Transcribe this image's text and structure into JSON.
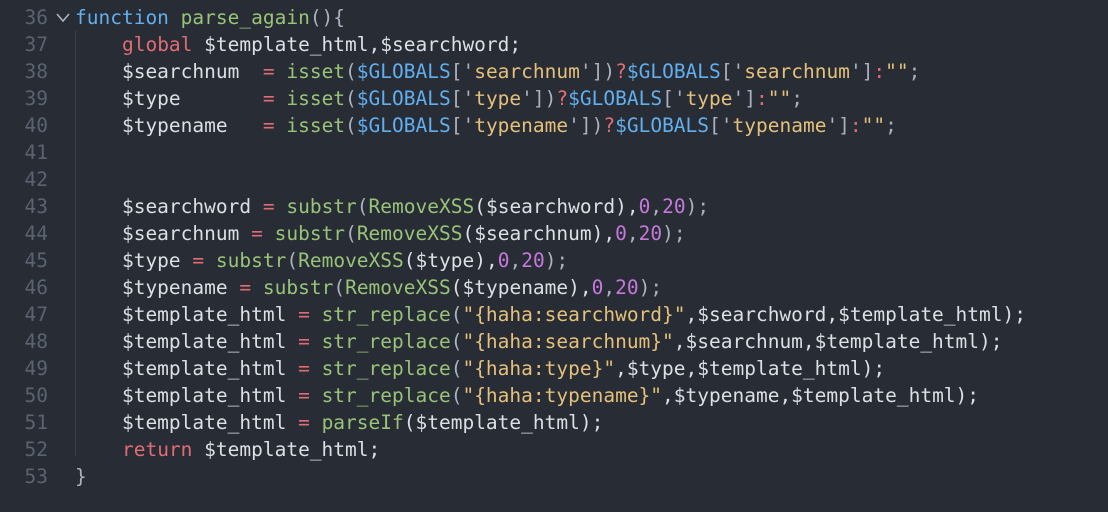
{
  "editor": {
    "lines": [
      {
        "num": "36",
        "tokens": [
          {
            "t": "function",
            "c": "kw-fn"
          },
          {
            "t": " ",
            "c": "var"
          },
          {
            "t": "parse_again",
            "c": "fn"
          },
          {
            "t": "(){",
            "c": "punc"
          }
        ]
      },
      {
        "num": "37",
        "tokens": [
          {
            "t": "    ",
            "c": "var"
          },
          {
            "t": "global",
            "c": "kw"
          },
          {
            "t": " $template_html,$searchword;",
            "c": "var"
          }
        ]
      },
      {
        "num": "38",
        "tokens": [
          {
            "t": "    $searchnum  ",
            "c": "var"
          },
          {
            "t": "=",
            "c": "op"
          },
          {
            "t": " ",
            "c": "var"
          },
          {
            "t": "isset",
            "c": "fn"
          },
          {
            "t": "(",
            "c": "punc"
          },
          {
            "t": "$GLOBALS",
            "c": "glob"
          },
          {
            "t": "['",
            "c": "punc"
          },
          {
            "t": "searchnum",
            "c": "str"
          },
          {
            "t": "'])",
            "c": "punc"
          },
          {
            "t": "?",
            "c": "op"
          },
          {
            "t": "$GLOBALS",
            "c": "glob"
          },
          {
            "t": "['",
            "c": "punc"
          },
          {
            "t": "searchnum",
            "c": "str"
          },
          {
            "t": "']",
            "c": "punc"
          },
          {
            "t": ":",
            "c": "op"
          },
          {
            "t": "\"\"",
            "c": "str"
          },
          {
            "t": ";",
            "c": "punc"
          }
        ]
      },
      {
        "num": "39",
        "tokens": [
          {
            "t": "    $type       ",
            "c": "var"
          },
          {
            "t": "=",
            "c": "op"
          },
          {
            "t": " ",
            "c": "var"
          },
          {
            "t": "isset",
            "c": "fn"
          },
          {
            "t": "(",
            "c": "punc"
          },
          {
            "t": "$GLOBALS",
            "c": "glob"
          },
          {
            "t": "['",
            "c": "punc"
          },
          {
            "t": "type",
            "c": "str"
          },
          {
            "t": "'])",
            "c": "punc"
          },
          {
            "t": "?",
            "c": "op"
          },
          {
            "t": "$GLOBALS",
            "c": "glob"
          },
          {
            "t": "['",
            "c": "punc"
          },
          {
            "t": "type",
            "c": "str"
          },
          {
            "t": "']",
            "c": "punc"
          },
          {
            "t": ":",
            "c": "op"
          },
          {
            "t": "\"\"",
            "c": "str"
          },
          {
            "t": ";",
            "c": "punc"
          }
        ]
      },
      {
        "num": "40",
        "tokens": [
          {
            "t": "    $typename   ",
            "c": "var"
          },
          {
            "t": "=",
            "c": "op"
          },
          {
            "t": " ",
            "c": "var"
          },
          {
            "t": "isset",
            "c": "fn"
          },
          {
            "t": "(",
            "c": "punc"
          },
          {
            "t": "$GLOBALS",
            "c": "glob"
          },
          {
            "t": "['",
            "c": "punc"
          },
          {
            "t": "typename",
            "c": "str"
          },
          {
            "t": "'])",
            "c": "punc"
          },
          {
            "t": "?",
            "c": "op"
          },
          {
            "t": "$GLOBALS",
            "c": "glob"
          },
          {
            "t": "['",
            "c": "punc"
          },
          {
            "t": "typename",
            "c": "str"
          },
          {
            "t": "']",
            "c": "punc"
          },
          {
            "t": ":",
            "c": "op"
          },
          {
            "t": "\"\"",
            "c": "str"
          },
          {
            "t": ";",
            "c": "punc"
          }
        ]
      },
      {
        "num": "41",
        "tokens": []
      },
      {
        "num": "42",
        "tokens": []
      },
      {
        "num": "43",
        "tokens": [
          {
            "t": "    $searchword ",
            "c": "var"
          },
          {
            "t": "=",
            "c": "op"
          },
          {
            "t": " ",
            "c": "var"
          },
          {
            "t": "substr",
            "c": "fn"
          },
          {
            "t": "(",
            "c": "punc"
          },
          {
            "t": "RemoveXSS",
            "c": "fn"
          },
          {
            "t": "($searchword),",
            "c": "var"
          },
          {
            "t": "0",
            "c": "num"
          },
          {
            "t": ",",
            "c": "punc"
          },
          {
            "t": "20",
            "c": "num"
          },
          {
            "t": ");",
            "c": "punc"
          }
        ]
      },
      {
        "num": "44",
        "tokens": [
          {
            "t": "    $searchnum ",
            "c": "var"
          },
          {
            "t": "=",
            "c": "op"
          },
          {
            "t": " ",
            "c": "var"
          },
          {
            "t": "substr",
            "c": "fn"
          },
          {
            "t": "(",
            "c": "punc"
          },
          {
            "t": "RemoveXSS",
            "c": "fn"
          },
          {
            "t": "($searchnum),",
            "c": "var"
          },
          {
            "t": "0",
            "c": "num"
          },
          {
            "t": ",",
            "c": "punc"
          },
          {
            "t": "20",
            "c": "num"
          },
          {
            "t": ");",
            "c": "punc"
          }
        ]
      },
      {
        "num": "45",
        "tokens": [
          {
            "t": "    $type ",
            "c": "var"
          },
          {
            "t": "=",
            "c": "op"
          },
          {
            "t": " ",
            "c": "var"
          },
          {
            "t": "substr",
            "c": "fn"
          },
          {
            "t": "(",
            "c": "punc"
          },
          {
            "t": "RemoveXSS",
            "c": "fn"
          },
          {
            "t": "($type),",
            "c": "var"
          },
          {
            "t": "0",
            "c": "num"
          },
          {
            "t": ",",
            "c": "punc"
          },
          {
            "t": "20",
            "c": "num"
          },
          {
            "t": ");",
            "c": "punc"
          }
        ]
      },
      {
        "num": "46",
        "tokens": [
          {
            "t": "    $typename ",
            "c": "var"
          },
          {
            "t": "=",
            "c": "op"
          },
          {
            "t": " ",
            "c": "var"
          },
          {
            "t": "substr",
            "c": "fn"
          },
          {
            "t": "(",
            "c": "punc"
          },
          {
            "t": "RemoveXSS",
            "c": "fn"
          },
          {
            "t": "($typename),",
            "c": "var"
          },
          {
            "t": "0",
            "c": "num"
          },
          {
            "t": ",",
            "c": "punc"
          },
          {
            "t": "20",
            "c": "num"
          },
          {
            "t": ");",
            "c": "punc"
          }
        ]
      },
      {
        "num": "47",
        "tokens": [
          {
            "t": "    $template_html ",
            "c": "var"
          },
          {
            "t": "=",
            "c": "op"
          },
          {
            "t": " ",
            "c": "var"
          },
          {
            "t": "str_replace",
            "c": "fn"
          },
          {
            "t": "(",
            "c": "punc"
          },
          {
            "t": "\"{haha:searchword}\"",
            "c": "str"
          },
          {
            "t": ",$searchword,$template_html);",
            "c": "var"
          }
        ]
      },
      {
        "num": "48",
        "tokens": [
          {
            "t": "    $template_html ",
            "c": "var"
          },
          {
            "t": "=",
            "c": "op"
          },
          {
            "t": " ",
            "c": "var"
          },
          {
            "t": "str_replace",
            "c": "fn"
          },
          {
            "t": "(",
            "c": "punc"
          },
          {
            "t": "\"{haha:searchnum}\"",
            "c": "str"
          },
          {
            "t": ",$searchnum,$template_html);",
            "c": "var"
          }
        ]
      },
      {
        "num": "49",
        "tokens": [
          {
            "t": "    $template_html ",
            "c": "var"
          },
          {
            "t": "=",
            "c": "op"
          },
          {
            "t": " ",
            "c": "var"
          },
          {
            "t": "str_replace",
            "c": "fn"
          },
          {
            "t": "(",
            "c": "punc"
          },
          {
            "t": "\"{haha:type}\"",
            "c": "str"
          },
          {
            "t": ",$type,$template_html);",
            "c": "var"
          }
        ]
      },
      {
        "num": "50",
        "tokens": [
          {
            "t": "    $template_html ",
            "c": "var"
          },
          {
            "t": "=",
            "c": "op"
          },
          {
            "t": " ",
            "c": "var"
          },
          {
            "t": "str_replace",
            "c": "fn"
          },
          {
            "t": "(",
            "c": "punc"
          },
          {
            "t": "\"{haha:typename}\"",
            "c": "str"
          },
          {
            "t": ",$typename,$template_html);",
            "c": "var"
          }
        ]
      },
      {
        "num": "51",
        "tokens": [
          {
            "t": "    $template_html ",
            "c": "var"
          },
          {
            "t": "=",
            "c": "op"
          },
          {
            "t": " ",
            "c": "var"
          },
          {
            "t": "parseIf",
            "c": "fn"
          },
          {
            "t": "($template_html);",
            "c": "var"
          }
        ]
      },
      {
        "num": "52",
        "tokens": [
          {
            "t": "    ",
            "c": "var"
          },
          {
            "t": "return",
            "c": "kw"
          },
          {
            "t": " $template_html;",
            "c": "var"
          }
        ]
      },
      {
        "num": "53",
        "tokens": [
          {
            "t": "}",
            "c": "punc"
          }
        ]
      }
    ],
    "fold_icon": "chevron-down-icon"
  }
}
